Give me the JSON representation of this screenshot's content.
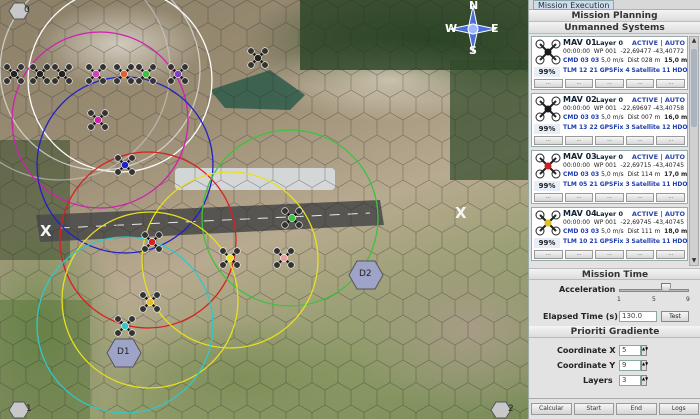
{
  "map": {
    "corner_top_left": "0",
    "corner_bottom_left": "1",
    "corner_bottom_right": "2",
    "compass": {
      "n": "N",
      "s": "S",
      "e": "E",
      "w": "W"
    },
    "runway_left": "X",
    "runway_right": "X",
    "targets": [
      {
        "label": "D1"
      },
      {
        "label": "D2"
      }
    ]
  },
  "panel": {
    "tab_label": "Mission Execution",
    "section_title": "Mission Planning",
    "units_title": "Unmanned Systems",
    "units": [
      {
        "name": "MAV 01",
        "layer": "Layer 0",
        "status": "ACTIVE | AUTO",
        "time": "00:00:00",
        "wp": "WP 001",
        "lat": "-22,69477",
        "lon": "-43,40772",
        "cmd": "CMD 03 03",
        "speed": "5,0 m/s",
        "dist": "Dist 028 m",
        "alt": "15,0 m",
        "pct": "99%",
        "tlm": "TLM 12 21",
        "gps": "GPSFix 4",
        "sat": "Satellite 11",
        "hdop": "HDOP 1",
        "color": "#1a1a1a"
      },
      {
        "name": "MAV 02",
        "layer": "Layer 0",
        "status": "ACTIVE | AUTO",
        "time": "00:00:00",
        "wp": "WP 001",
        "lat": "-22,69697",
        "lon": "-43,40758",
        "cmd": "CMD 03 03",
        "speed": "5,0 m/s",
        "dist": "Dist 007 m",
        "alt": "16,0 m",
        "pct": "99%",
        "tlm": "TLM 13 22",
        "gps": "GPSFix 3",
        "sat": "Satellite 12",
        "hdop": "HDOP 1",
        "color": "#1a1a1a"
      },
      {
        "name": "MAV 03",
        "layer": "Layer 0",
        "status": "ACTIVE | AUTO",
        "time": "00:00:00",
        "wp": "WP 001",
        "lat": "-22,69715",
        "lon": "-43,40745",
        "cmd": "CMD 03 03",
        "speed": "5,0 m/s",
        "dist": "Dist 114 m",
        "alt": "17,0 m",
        "pct": "99%",
        "tlm": "TLM 05 21",
        "gps": "GPSFix 3",
        "sat": "Satellite 11",
        "hdop": "HDOP 1",
        "color": "#d02020"
      },
      {
        "name": "MAV 04",
        "layer": "Layer 0",
        "status": "ACTIVE | AUTO",
        "time": "00:00:00",
        "wp": "WP 001",
        "lat": "-22,69745",
        "lon": "-43,40745",
        "cmd": "CMD 03 03",
        "speed": "5,0 m/s",
        "dist": "Dist 111 m",
        "alt": "18,0 m",
        "pct": "99%",
        "tlm": "TLM 10 21",
        "gps": "GPSFix 3",
        "sat": "Satellite 11",
        "hdop": "HDOP 1",
        "color": "#e0c020"
      }
    ],
    "mission_time": {
      "title": "Mission Time",
      "acceleration_label": "Acceleration",
      "ticks": [
        "1",
        "5",
        "9"
      ],
      "acceleration_value": 6,
      "elapsed_label": "Elapsed Time (s)",
      "elapsed_value": "130.0",
      "test_button": "Test"
    },
    "gradient": {
      "title": "Prioriti Gradiente",
      "coord_x_label": "Coordinate X",
      "coord_x_value": "5",
      "coord_y_label": "Coordinate Y",
      "coord_y_value": "9",
      "layers_label": "Layers",
      "layers_value": "3"
    },
    "bottom_buttons": [
      "Calcular",
      "Start",
      "End",
      "Logs"
    ]
  }
}
